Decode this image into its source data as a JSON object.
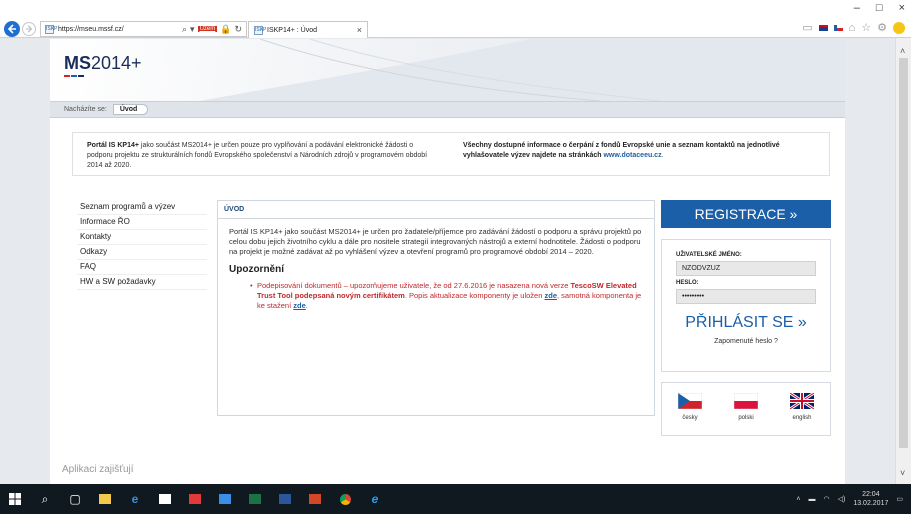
{
  "browser": {
    "url": "https://mseu.mssf.cz/",
    "tab_title": "ISKP14+ : Úvod",
    "favicon_text": "ISKP",
    "cert_badge": "Uzem"
  },
  "site": {
    "logo_bold": "MS",
    "logo_rest": "2014+",
    "logo_bar_colors": [
      "#d2232a",
      "#1b5fa8",
      "#1a2d5a"
    ]
  },
  "breadcrumb": {
    "prefix": "Nacházíte se:",
    "current": "Úvod"
  },
  "infobar": {
    "left_bold": "Portál IS KP14+",
    "left_text": " jako součást MS2014+ je určen pouze pro vyplňování a podávání elektronické žádosti o podporu projektu ze strukturálních fondů Evropského společenství a Národních zdrojů v programovém období 2014 až 2020.",
    "right_bold": "Všechny dostupné informace o čerpání z fondů Evropské unie a seznam kontaktů na jednotlivé vyhlašovatele výzev najdete na stránkách",
    "right_link": "www.dotaceeu.cz",
    "right_end": "."
  },
  "sidemenu": [
    {
      "label": "Seznam programů a výzev"
    },
    {
      "label": "Informace ŘO"
    },
    {
      "label": "Kontakty"
    },
    {
      "label": "Odkazy"
    },
    {
      "label": "FAQ"
    },
    {
      "label": "HW a SW požadavky"
    }
  ],
  "main": {
    "title": "ÚVOD",
    "intro": "Portál IS KP14+ jako součást MS2014+ je určen pro žadatele/příjemce pro zadávání žádostí o podporu a správu projektů po celou dobu jejich životního cyklu a dále pro nositele strategií integrovaných nástrojů a externí hodnotitele. Žádosti o podporu na projekt je možné zadávat až po vyhlášení výzev a otevření programů pro programové období 2014 – 2020.",
    "warning_heading": "Upozornění",
    "warning_text1": "Podepisování dokumentů – upozorňujeme uživatele, že od 27.6.2016 je nasazena nová verze ",
    "warning_bold": "TescoSW Elevated Trust Tool podepsaná novým certifikátem",
    "warning_text2": ". Popis aktualizace komponenty je uložen ",
    "link1": "zde",
    "warning_text3": ", samotná komponenta je ke stažení ",
    "link2": "zde",
    "warning_end": "."
  },
  "login": {
    "register_label": "REGISTRACE »",
    "username_label": "UŽIVATELSKÉ JMÉNO:",
    "username_value": "NZODVZUZ",
    "password_label": "HESLO:",
    "password_value": "•••••••••",
    "login_label": "PŘIHLÁSIT SE »",
    "forgot_label": "Zapomenuté heslo ?"
  },
  "languages": [
    {
      "label": "česky"
    },
    {
      "label": "polski"
    },
    {
      "label": "english"
    }
  ],
  "footer": {
    "app_text": "Aplikaci zajišťují"
  },
  "taskbar": {
    "time": "22:04",
    "date": "13.02.2017"
  },
  "colors": {
    "accent_blue": "#1b5fa8",
    "warning_red": "#c0282d",
    "taskbar": "#101820"
  }
}
